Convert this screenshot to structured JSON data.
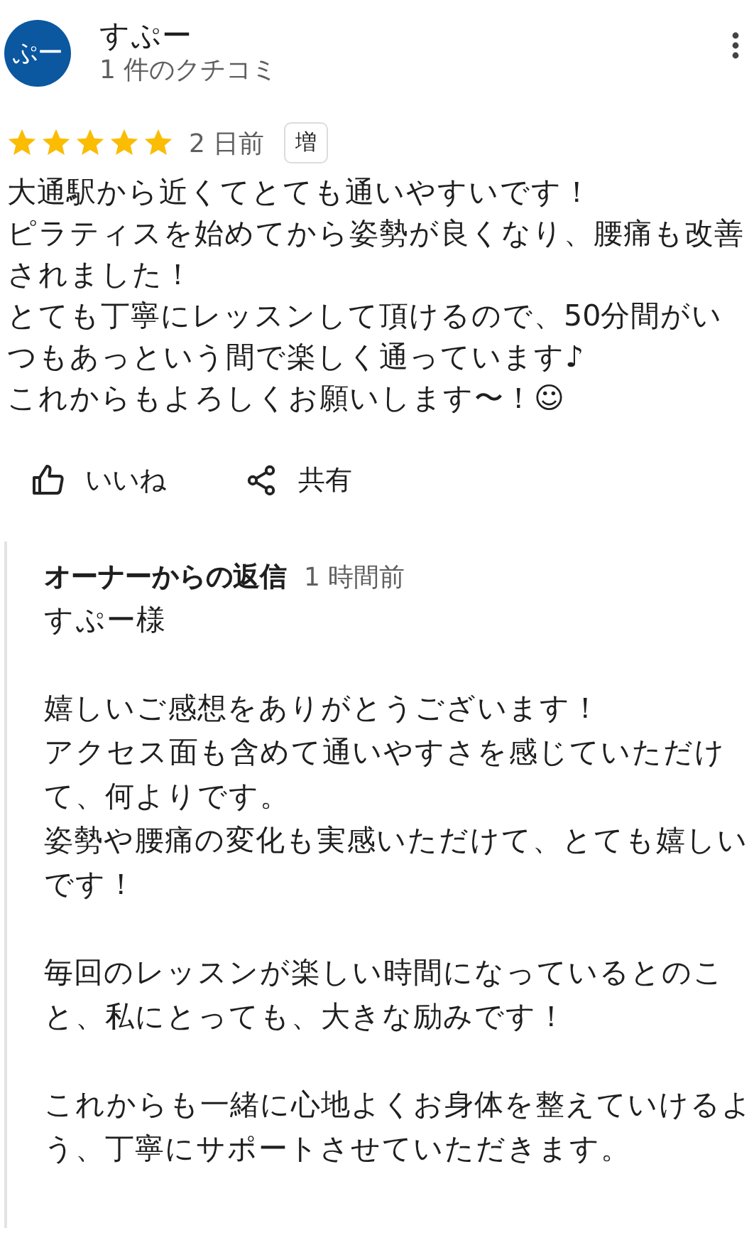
{
  "reviewer": {
    "avatar_text": "ぷー",
    "name": "すぷー",
    "review_count": "1 件のクチコミ"
  },
  "review": {
    "stars": 5,
    "time": "2 日前",
    "badge": "増",
    "lines": [
      "大通駅から近くてとても通いやすいです！",
      "ピラティスを始めてから姿勢が良くなり、腰痛も改善されました！",
      "とても丁寧にレッスンして頂けるので、50分間がいつもあっという間で楽しく通っています♪",
      "これからもよろしくお願いします〜！☺"
    ]
  },
  "actions": [
    {
      "kind": "like",
      "label": "いいね"
    },
    {
      "kind": "share",
      "label": "共有"
    }
  ],
  "owner_reply": {
    "title": "オーナーからの返信",
    "time": "1 時間前",
    "paragraphs": [
      [
        "すぷー様"
      ],
      [
        "嬉しいご感想をありがとうございます！",
        "アクセス面も含めて通いやすさを感じていただけて、何よりです。",
        "姿勢や腰痛の変化も実感いただけて、とても嬉しいです！"
      ],
      [
        "毎回のレッスンが楽しい時間になっているとのこと、私にとっても、大きな励みです！"
      ],
      [
        "これからも一緒に心地よくお身体を整えていけるよう、丁寧にサポートさせていただきます。"
      ]
    ]
  }
}
